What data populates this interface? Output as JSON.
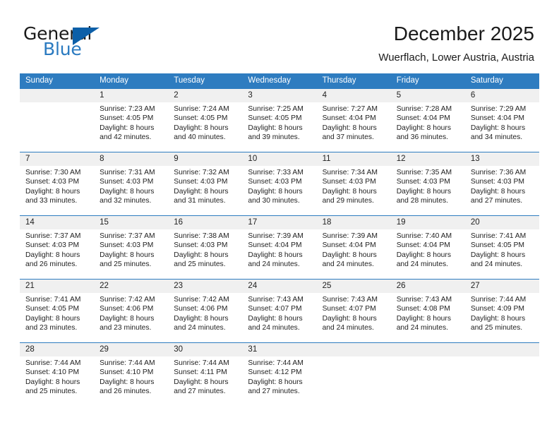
{
  "brand": {
    "name_part1": "General",
    "name_part2": "Blue",
    "flag_icon": "triangle-flag-icon"
  },
  "header": {
    "title": "December 2025",
    "subtitle": "Wuerflach, Lower Austria, Austria"
  },
  "colors": {
    "header_blue": "#2e7cc0",
    "brand_blue": "#2a7ac0",
    "flag_blue": "#0c5fa8",
    "daynum_band": "#f0f0f0",
    "text": "#222222"
  },
  "weekdays": [
    "Sunday",
    "Monday",
    "Tuesday",
    "Wednesday",
    "Thursday",
    "Friday",
    "Saturday"
  ],
  "weeks": [
    [
      {
        "day": "",
        "sunrise": "",
        "sunset": "",
        "daylight1": "",
        "daylight2": "",
        "empty": true
      },
      {
        "day": "1",
        "sunrise": "Sunrise: 7:23 AM",
        "sunset": "Sunset: 4:05 PM",
        "daylight1": "Daylight: 8 hours",
        "daylight2": "and 42 minutes."
      },
      {
        "day": "2",
        "sunrise": "Sunrise: 7:24 AM",
        "sunset": "Sunset: 4:05 PM",
        "daylight1": "Daylight: 8 hours",
        "daylight2": "and 40 minutes."
      },
      {
        "day": "3",
        "sunrise": "Sunrise: 7:25 AM",
        "sunset": "Sunset: 4:05 PM",
        "daylight1": "Daylight: 8 hours",
        "daylight2": "and 39 minutes."
      },
      {
        "day": "4",
        "sunrise": "Sunrise: 7:27 AM",
        "sunset": "Sunset: 4:04 PM",
        "daylight1": "Daylight: 8 hours",
        "daylight2": "and 37 minutes."
      },
      {
        "day": "5",
        "sunrise": "Sunrise: 7:28 AM",
        "sunset": "Sunset: 4:04 PM",
        "daylight1": "Daylight: 8 hours",
        "daylight2": "and 36 minutes."
      },
      {
        "day": "6",
        "sunrise": "Sunrise: 7:29 AM",
        "sunset": "Sunset: 4:04 PM",
        "daylight1": "Daylight: 8 hours",
        "daylight2": "and 34 minutes."
      }
    ],
    [
      {
        "day": "7",
        "sunrise": "Sunrise: 7:30 AM",
        "sunset": "Sunset: 4:03 PM",
        "daylight1": "Daylight: 8 hours",
        "daylight2": "and 33 minutes."
      },
      {
        "day": "8",
        "sunrise": "Sunrise: 7:31 AM",
        "sunset": "Sunset: 4:03 PM",
        "daylight1": "Daylight: 8 hours",
        "daylight2": "and 32 minutes."
      },
      {
        "day": "9",
        "sunrise": "Sunrise: 7:32 AM",
        "sunset": "Sunset: 4:03 PM",
        "daylight1": "Daylight: 8 hours",
        "daylight2": "and 31 minutes."
      },
      {
        "day": "10",
        "sunrise": "Sunrise: 7:33 AM",
        "sunset": "Sunset: 4:03 PM",
        "daylight1": "Daylight: 8 hours",
        "daylight2": "and 30 minutes."
      },
      {
        "day": "11",
        "sunrise": "Sunrise: 7:34 AM",
        "sunset": "Sunset: 4:03 PM",
        "daylight1": "Daylight: 8 hours",
        "daylight2": "and 29 minutes."
      },
      {
        "day": "12",
        "sunrise": "Sunrise: 7:35 AM",
        "sunset": "Sunset: 4:03 PM",
        "daylight1": "Daylight: 8 hours",
        "daylight2": "and 28 minutes."
      },
      {
        "day": "13",
        "sunrise": "Sunrise: 7:36 AM",
        "sunset": "Sunset: 4:03 PM",
        "daylight1": "Daylight: 8 hours",
        "daylight2": "and 27 minutes."
      }
    ],
    [
      {
        "day": "14",
        "sunrise": "Sunrise: 7:37 AM",
        "sunset": "Sunset: 4:03 PM",
        "daylight1": "Daylight: 8 hours",
        "daylight2": "and 26 minutes."
      },
      {
        "day": "15",
        "sunrise": "Sunrise: 7:37 AM",
        "sunset": "Sunset: 4:03 PM",
        "daylight1": "Daylight: 8 hours",
        "daylight2": "and 25 minutes."
      },
      {
        "day": "16",
        "sunrise": "Sunrise: 7:38 AM",
        "sunset": "Sunset: 4:03 PM",
        "daylight1": "Daylight: 8 hours",
        "daylight2": "and 25 minutes."
      },
      {
        "day": "17",
        "sunrise": "Sunrise: 7:39 AM",
        "sunset": "Sunset: 4:04 PM",
        "daylight1": "Daylight: 8 hours",
        "daylight2": "and 24 minutes."
      },
      {
        "day": "18",
        "sunrise": "Sunrise: 7:39 AM",
        "sunset": "Sunset: 4:04 PM",
        "daylight1": "Daylight: 8 hours",
        "daylight2": "and 24 minutes."
      },
      {
        "day": "19",
        "sunrise": "Sunrise: 7:40 AM",
        "sunset": "Sunset: 4:04 PM",
        "daylight1": "Daylight: 8 hours",
        "daylight2": "and 24 minutes."
      },
      {
        "day": "20",
        "sunrise": "Sunrise: 7:41 AM",
        "sunset": "Sunset: 4:05 PM",
        "daylight1": "Daylight: 8 hours",
        "daylight2": "and 24 minutes."
      }
    ],
    [
      {
        "day": "21",
        "sunrise": "Sunrise: 7:41 AM",
        "sunset": "Sunset: 4:05 PM",
        "daylight1": "Daylight: 8 hours",
        "daylight2": "and 23 minutes."
      },
      {
        "day": "22",
        "sunrise": "Sunrise: 7:42 AM",
        "sunset": "Sunset: 4:06 PM",
        "daylight1": "Daylight: 8 hours",
        "daylight2": "and 23 minutes."
      },
      {
        "day": "23",
        "sunrise": "Sunrise: 7:42 AM",
        "sunset": "Sunset: 4:06 PM",
        "daylight1": "Daylight: 8 hours",
        "daylight2": "and 24 minutes."
      },
      {
        "day": "24",
        "sunrise": "Sunrise: 7:43 AM",
        "sunset": "Sunset: 4:07 PM",
        "daylight1": "Daylight: 8 hours",
        "daylight2": "and 24 minutes."
      },
      {
        "day": "25",
        "sunrise": "Sunrise: 7:43 AM",
        "sunset": "Sunset: 4:07 PM",
        "daylight1": "Daylight: 8 hours",
        "daylight2": "and 24 minutes."
      },
      {
        "day": "26",
        "sunrise": "Sunrise: 7:43 AM",
        "sunset": "Sunset: 4:08 PM",
        "daylight1": "Daylight: 8 hours",
        "daylight2": "and 24 minutes."
      },
      {
        "day": "27",
        "sunrise": "Sunrise: 7:44 AM",
        "sunset": "Sunset: 4:09 PM",
        "daylight1": "Daylight: 8 hours",
        "daylight2": "and 25 minutes."
      }
    ],
    [
      {
        "day": "28",
        "sunrise": "Sunrise: 7:44 AM",
        "sunset": "Sunset: 4:10 PM",
        "daylight1": "Daylight: 8 hours",
        "daylight2": "and 25 minutes."
      },
      {
        "day": "29",
        "sunrise": "Sunrise: 7:44 AM",
        "sunset": "Sunset: 4:10 PM",
        "daylight1": "Daylight: 8 hours",
        "daylight2": "and 26 minutes."
      },
      {
        "day": "30",
        "sunrise": "Sunrise: 7:44 AM",
        "sunset": "Sunset: 4:11 PM",
        "daylight1": "Daylight: 8 hours",
        "daylight2": "and 27 minutes."
      },
      {
        "day": "31",
        "sunrise": "Sunrise: 7:44 AM",
        "sunset": "Sunset: 4:12 PM",
        "daylight1": "Daylight: 8 hours",
        "daylight2": "and 27 minutes."
      },
      {
        "day": "",
        "sunrise": "",
        "sunset": "",
        "daylight1": "",
        "daylight2": "",
        "empty": true
      },
      {
        "day": "",
        "sunrise": "",
        "sunset": "",
        "daylight1": "",
        "daylight2": "",
        "empty": true
      },
      {
        "day": "",
        "sunrise": "",
        "sunset": "",
        "daylight1": "",
        "daylight2": "",
        "empty": true
      }
    ]
  ]
}
